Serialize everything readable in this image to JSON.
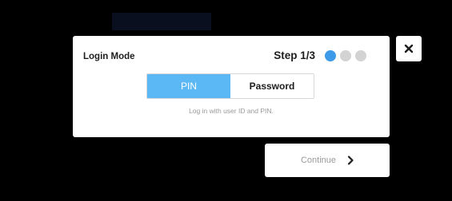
{
  "dialog": {
    "title": "Login Mode",
    "step_label": "Step 1/3",
    "step_progress": {
      "current": 1,
      "total": 3
    },
    "step_dots": [
      {
        "color": "#3d9be9"
      },
      {
        "color": "#d3d3d3"
      },
      {
        "color": "#d3d3d3"
      }
    ],
    "modes": [
      {
        "label": "PIN",
        "selected": true
      },
      {
        "label": "Password",
        "selected": false
      }
    ],
    "hint": "Log in with user ID and PIN."
  },
  "close_button": {
    "icon": "close-icon"
  },
  "continue_button": {
    "label": "Continue",
    "icon": "chevron-right-icon"
  },
  "colors": {
    "background": "#000000",
    "accent": "#5bb8f5",
    "step_active": "#3d9be9",
    "step_inactive": "#d3d3d3",
    "muted_text": "#9a9a9a"
  }
}
